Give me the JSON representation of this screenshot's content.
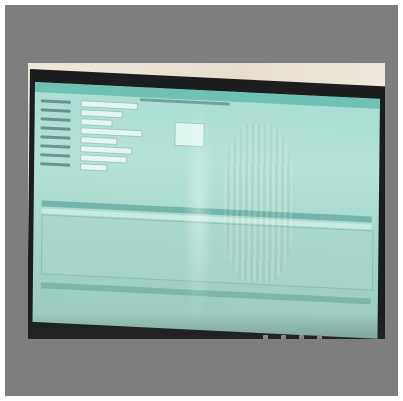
{
  "photo": {
    "subject": "",
    "screen_color": "#a9ddd3",
    "bezel_color": "#1b1d1f",
    "border_color": "#7e7e7e"
  }
}
